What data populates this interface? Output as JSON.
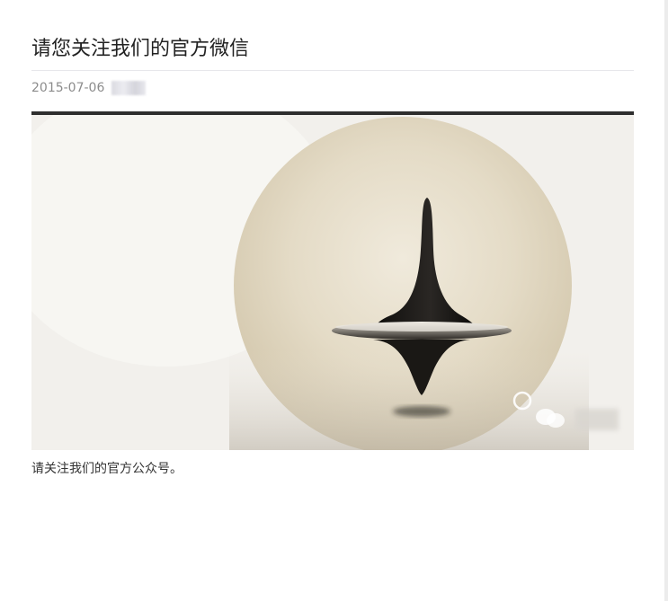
{
  "article": {
    "title": "请您关注我们的官方微信",
    "date": "2015-07-06",
    "caption": "请关注我们的官方公众号。"
  },
  "image": {
    "subject": "spinning-top",
    "watermark_icon": "wechat-icon"
  },
  "colors": {
    "title": "#222222",
    "meta": "#8c8c8c",
    "divider": "#e7e7eb",
    "image_top_border": "#2e2e2e",
    "caption": "#333333"
  }
}
